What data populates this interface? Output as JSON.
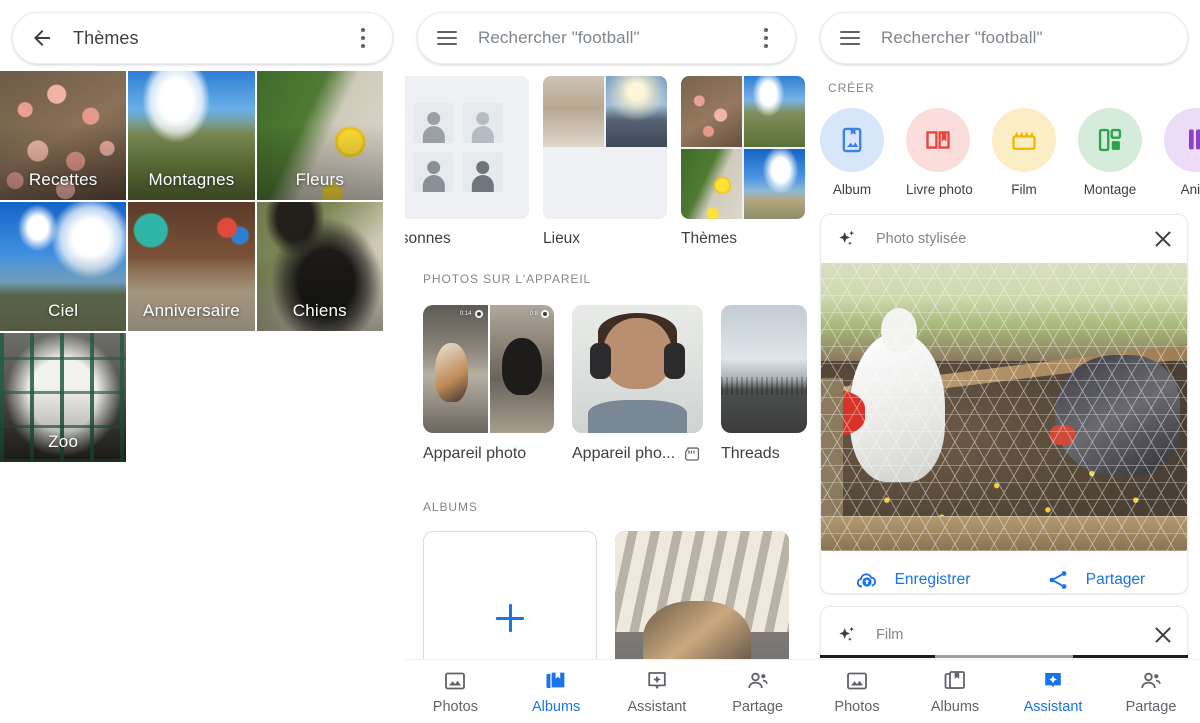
{
  "panel_themes": {
    "appbar": {
      "title": "Thèmes",
      "back_icon": "arrow-back-icon",
      "menu_icon": "more-vert-icon"
    },
    "tiles": [
      {
        "label": "Recettes"
      },
      {
        "label": "Montagnes"
      },
      {
        "label": "Fleurs"
      },
      {
        "label": "Ciel"
      },
      {
        "label": "Anniversaire"
      },
      {
        "label": "Chiens"
      },
      {
        "label": "Zoo"
      }
    ]
  },
  "panel_albums": {
    "appbar": {
      "placeholder": "Rechercher \"football\"",
      "menu_icon": "hamburger-icon",
      "overflow_icon": "more-vert-icon"
    },
    "categories": [
      {
        "label": "ersonnes",
        "full_label": "Personnes"
      },
      {
        "label": "Lieux"
      },
      {
        "label": "Thèmes"
      }
    ],
    "device_section_title": "PHOTOS SUR L'APPAREIL",
    "device_items": [
      {
        "label": "Appareil photo",
        "badge": ""
      },
      {
        "label": "Appareil pho...",
        "badge": "sd-card-icon"
      },
      {
        "label": "Threads",
        "badge": ""
      }
    ],
    "albums_section_title": "ALBUMS",
    "album_new_icon": "plus-icon",
    "bottom_nav": [
      {
        "label": "Photos",
        "icon": "photo-icon",
        "active": false
      },
      {
        "label": "Albums",
        "icon": "albums-icon",
        "active": true
      },
      {
        "label": "Assistant",
        "icon": "assistant-icon",
        "active": false
      },
      {
        "label": "Partage",
        "icon": "people-icon",
        "active": false
      }
    ]
  },
  "panel_assistant": {
    "appbar": {
      "placeholder": "Rechercher \"football\"",
      "menu_icon": "hamburger-icon"
    },
    "creer_title": "CRÉER",
    "creer_items": [
      {
        "label": "Album",
        "icon": "album-icon",
        "bg": "#d7e6fb",
        "fg": "#3b82e8"
      },
      {
        "label": "Livre photo",
        "icon": "photobook-icon",
        "bg": "#fbdedb",
        "fg": "#e8453c"
      },
      {
        "label": "Film",
        "icon": "movie-icon",
        "bg": "#fbeec4",
        "fg": "#f5b400"
      },
      {
        "label": "Montage",
        "icon": "collage-icon",
        "bg": "#d4ecd9",
        "fg": "#2ba24c"
      },
      {
        "label": "Anim",
        "full_label": "Animation",
        "icon": "animation-icon",
        "bg": "#eddcf7",
        "fg": "#8d3fd0"
      }
    ],
    "cards": [
      {
        "title": "Photo stylisée",
        "leading_icon": "sparkle-icon",
        "close_icon": "close-icon",
        "actions": [
          {
            "label": "Enregistrer",
            "icon": "cloud-upload-icon"
          },
          {
            "label": "Partager",
            "icon": "share-icon"
          }
        ]
      },
      {
        "title": "Film",
        "leading_icon": "sparkle-icon",
        "close_icon": "close-icon"
      }
    ],
    "bottom_nav": [
      {
        "label": "Photos",
        "icon": "photo-icon",
        "active": false
      },
      {
        "label": "Albums",
        "icon": "albums-icon",
        "active": false
      },
      {
        "label": "Assistant",
        "icon": "assistant-icon",
        "active": true
      },
      {
        "label": "Partage",
        "icon": "people-icon",
        "active": false
      }
    ]
  },
  "colors": {
    "accent": "#1a73e8",
    "text_primary": "#3c4043",
    "text_secondary": "#80868b"
  }
}
